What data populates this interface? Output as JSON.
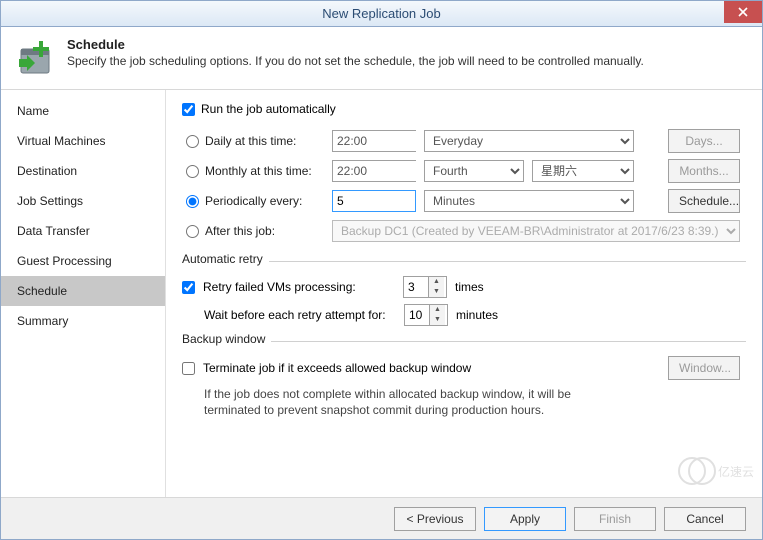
{
  "window": {
    "title": "New Replication Job"
  },
  "header": {
    "title": "Schedule",
    "subtitle": "Specify the job scheduling options. If you do not set the schedule, the job will need to be controlled manually."
  },
  "sidebar": {
    "items": [
      {
        "label": "Name"
      },
      {
        "label": "Virtual Machines"
      },
      {
        "label": "Destination"
      },
      {
        "label": "Job Settings"
      },
      {
        "label": "Data Transfer"
      },
      {
        "label": "Guest Processing"
      },
      {
        "label": "Schedule",
        "selected": true
      },
      {
        "label": "Summary"
      }
    ]
  },
  "schedule": {
    "auto_label": "Run the job automatically",
    "daily": {
      "label": "Daily at this time:",
      "time": "22:00",
      "day": "Everyday",
      "btn": "Days..."
    },
    "monthly": {
      "label": "Monthly at this time:",
      "time": "22:00",
      "ord": "Fourth",
      "dow": "星期六",
      "btn": "Months..."
    },
    "periodic": {
      "label": "Periodically every:",
      "value": "5",
      "unit": "Minutes",
      "btn": "Schedule..."
    },
    "after": {
      "label": "After this job:",
      "job": "Backup DC1 (Created by VEEAM-BR\\Administrator at 2017/6/23 8:39.)"
    }
  },
  "retry": {
    "legend": "Automatic retry",
    "enable": "Retry failed VMs processing:",
    "count": "3",
    "times": "times",
    "wait_label": "Wait before each retry attempt for:",
    "wait": "10",
    "minutes": "minutes"
  },
  "bw": {
    "legend": "Backup window",
    "enable": "Terminate job if it exceeds allowed backup window",
    "btn": "Window...",
    "hint": "If the job does not complete within allocated backup window, it will be terminated to prevent snapshot commit during production hours."
  },
  "footer": {
    "prev": "< Previous",
    "apply": "Apply",
    "finish": "Finish",
    "cancel": "Cancel"
  },
  "watermark": "亿速云"
}
